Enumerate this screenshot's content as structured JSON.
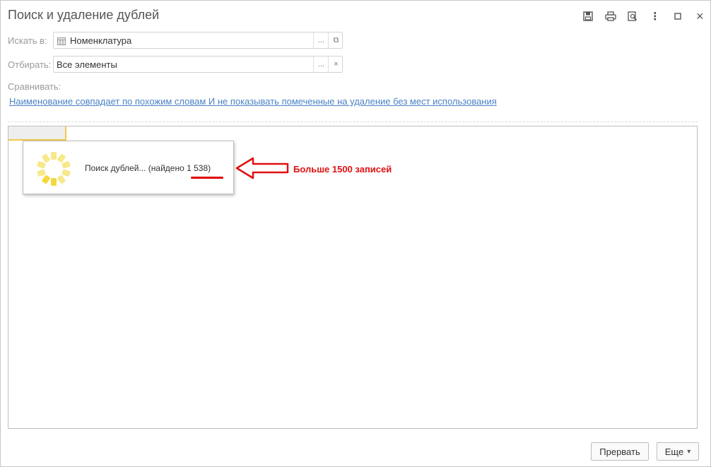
{
  "window": {
    "title": "Поиск и удаление дублей"
  },
  "toolbar": {
    "icons": [
      "save-icon",
      "print-icon",
      "preview-icon",
      "more-icon",
      "maximize-icon",
      "close-icon"
    ],
    "more_glyph": "⋮",
    "close_glyph": "×"
  },
  "search_in": {
    "label": "Искать в:",
    "value": "Номенклатура",
    "select_btn": "...",
    "open_btn": "⧉"
  },
  "filter": {
    "label": "Отбирать:",
    "value": "Все элементы",
    "select_btn": "...",
    "clear_btn": "×"
  },
  "compare": {
    "label": "Сравнивать:",
    "link": "Наименование совпадает по похожим словам И не показывать помеченные на удаление без мест использования"
  },
  "progress": {
    "text": "Поиск дублей... (найдено 1 538)"
  },
  "annotation": {
    "text": "Больше 1500 записей",
    "color": "#e01010"
  },
  "buttons": {
    "abort": "Прервать",
    "more": "Еще",
    "more_arrow": "▾"
  }
}
